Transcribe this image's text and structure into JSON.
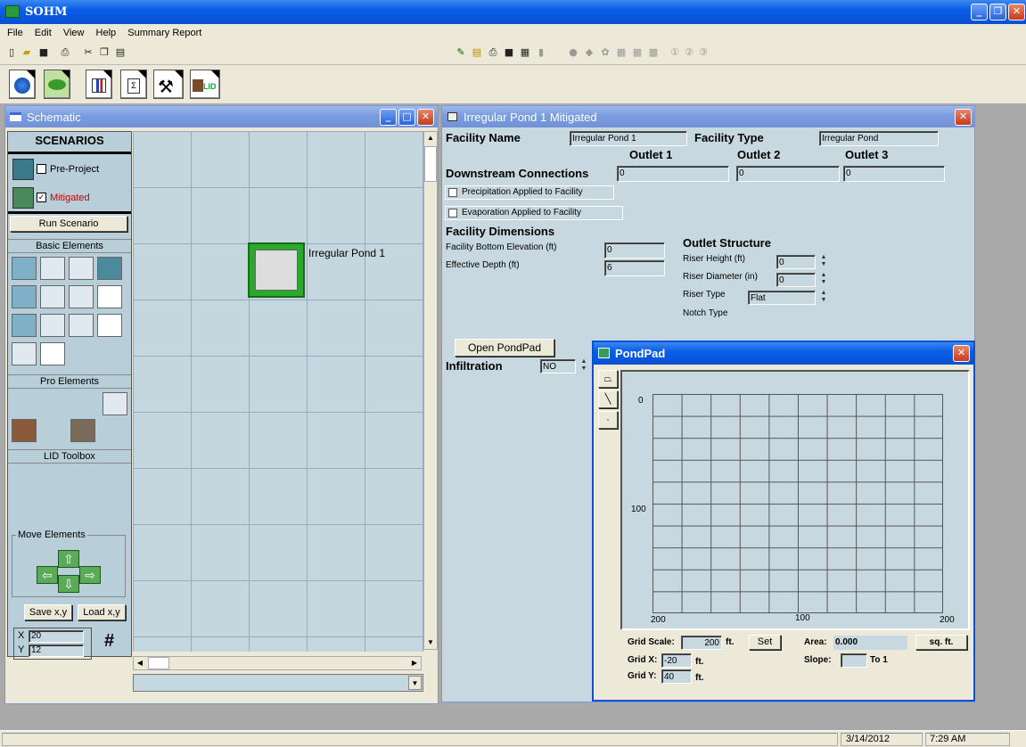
{
  "app": {
    "title": "SOHM"
  },
  "menu": [
    "File",
    "Edit",
    "View",
    "Help",
    "Summary Report"
  ],
  "toolbar_left_icons": [
    "new-icon",
    "open-icon",
    "save-icon",
    "print-icon",
    "cut-icon",
    "copy-icon",
    "paste-icon"
  ],
  "toolbar_right_icons": [
    "edit-icon",
    "notes-icon",
    "print-icon",
    "save-icon",
    "table-icon",
    "chart-icon",
    "record-icon",
    "run-icon",
    "settings-icon",
    "grid-icon",
    "grid2-icon",
    "compare-icon",
    "one-icon",
    "two-icon",
    "three-icon"
  ],
  "top_buttons": [
    "globe-icon",
    "frog-icon",
    "chart-icon",
    "report-icon",
    "tools-icon",
    "lid-icon"
  ],
  "top_button_lid_text": "LID",
  "schematic": {
    "title": "Schematic",
    "scenarios_header": "SCENARIOS",
    "pre_project": "Pre-Project",
    "mitigated": "Mitigated",
    "run_scenario": "Run Scenario",
    "basic_elements": "Basic Elements",
    "pro_elements": "Pro Elements",
    "lid_toolbox": "LID Toolbox",
    "move_elements": "Move Elements",
    "save_xy": "Save x,y",
    "load_xy": "Load x,y",
    "x_label": "X",
    "y_label": "Y",
    "x_value": "20",
    "y_value": "12",
    "grid_icon_text": "#",
    "element_label": "Irregular Pond  1"
  },
  "pond": {
    "title": "Irregular Pond  1 Mitigated",
    "facility_name_label": "Facility Name",
    "facility_name": "Irregular Pond  1",
    "facility_type_label": "Facility Type",
    "facility_type": "Irregular Pond",
    "outlet1": "Outlet 1",
    "outlet2": "Outlet 2",
    "outlet3": "Outlet 3",
    "downstream_label": "Downstream Connections",
    "outlet1_val": "0",
    "outlet2_val": "0",
    "outlet3_val": "0",
    "precip": "Precipitation Applied to Facility",
    "evap": "Evaporation Applied to Facility",
    "dimensions": "Facility Dimensions",
    "bottom_elev_label": "Facility Bottom Elevation (ft)",
    "bottom_elev": "0",
    "depth_label": "Effective Depth (ft)",
    "depth": "6",
    "outlet_structure": "Outlet Structure",
    "riser_height_label": "Riser Height (ft)",
    "riser_height": "0",
    "riser_diam_label": "Riser Diameter (in)",
    "riser_diam": "0",
    "riser_type_label": "Riser Type",
    "riser_type": "Flat",
    "notch_type_label": "Notch Type",
    "open_pondpad": "Open PondPad",
    "infiltration_label": "Infiltration",
    "infiltration": "NO"
  },
  "pondpad": {
    "title": "PondPad",
    "y0": "0",
    "y100": "100",
    "y200": "200",
    "x100": "100",
    "x200": "200",
    "grid_scale_label": "Grid Scale:",
    "grid_scale": "200",
    "ft": "ft.",
    "set": "Set",
    "area_label": "Area:",
    "area": "0.000",
    "sqft": "sq. ft.",
    "gridx_label": "Grid X:",
    "gridx": "-20",
    "gridy_label": "Grid Y:",
    "gridy": "40",
    "slope_label": "Slope:",
    "to1": "To 1"
  },
  "status": {
    "date": "3/14/2012",
    "time": "7:29 AM"
  },
  "colors": {
    "title_blue": "#0a5ee8",
    "panel_blue": "#c8d8e0",
    "grid_bg": "#c5d7de",
    "mitigated_red": "#cc0000"
  }
}
